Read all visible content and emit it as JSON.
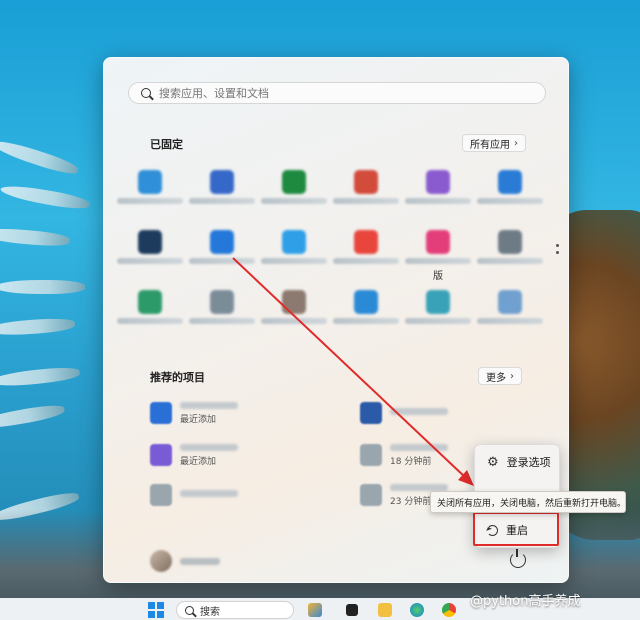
{
  "search": {
    "placeholder": "搜索应用、设置和文档"
  },
  "pinned": {
    "title": "已固定",
    "all_apps_label": "所有应用",
    "partial_label": "版",
    "apps": [
      {
        "icon": "app-icon",
        "color": "#2f8fd8"
      },
      {
        "icon": "app-icon",
        "color": "#3568c9"
      },
      {
        "icon": "app-icon",
        "color": "#1d8a3f"
      },
      {
        "icon": "app-icon",
        "color": "#d24b3b"
      },
      {
        "icon": "app-icon",
        "color": "#8a5bcf"
      },
      {
        "icon": "app-icon",
        "color": "#2a7bd6"
      },
      {
        "icon": "app-icon",
        "color": "#1d3b5c"
      },
      {
        "icon": "app-icon",
        "color": "#2378d9"
      },
      {
        "icon": "app-icon",
        "color": "#2f9fe8"
      },
      {
        "icon": "app-icon",
        "color": "#e8453c"
      },
      {
        "icon": "app-icon",
        "color": "#e33e7a"
      },
      {
        "icon": "app-icon",
        "color": "#6d7b86"
      },
      {
        "icon": "app-icon",
        "color": "#2d9a6a"
      },
      {
        "icon": "app-icon",
        "color": "#7b8c99"
      },
      {
        "icon": "app-icon",
        "color": "#8c7a70"
      },
      {
        "icon": "app-icon",
        "color": "#2a8ad6"
      },
      {
        "icon": "app-icon",
        "color": "#3aa2b8"
      },
      {
        "icon": "app-icon",
        "color": "#6fa0cf"
      }
    ]
  },
  "recommended": {
    "title": "推荐的项目",
    "more_label": "更多",
    "items": [
      {
        "sub": "最近添加",
        "color": "#2a6fd6"
      },
      {
        "sub": "",
        "color": "#2b5aa8"
      },
      {
        "sub": "最近添加",
        "color": "#7a5bd6"
      },
      {
        "sub": "18 分钟前",
        "color": "#9aa6ae"
      },
      {
        "sub": "",
        "color": "#9aa6ae"
      },
      {
        "sub": "23 分钟前",
        "color": "#9aa6ae"
      }
    ]
  },
  "power_menu": {
    "signin_options": "登录选项",
    "restart": "重启",
    "tooltip": "关闭所有应用，关闭电脑，然后重新打开电脑。"
  },
  "taskbar": {
    "search_label": "搜索",
    "watermark": "@python高手养成"
  },
  "colors": {
    "highlight": "#e02b2b",
    "arrow": "#e02b2b"
  }
}
